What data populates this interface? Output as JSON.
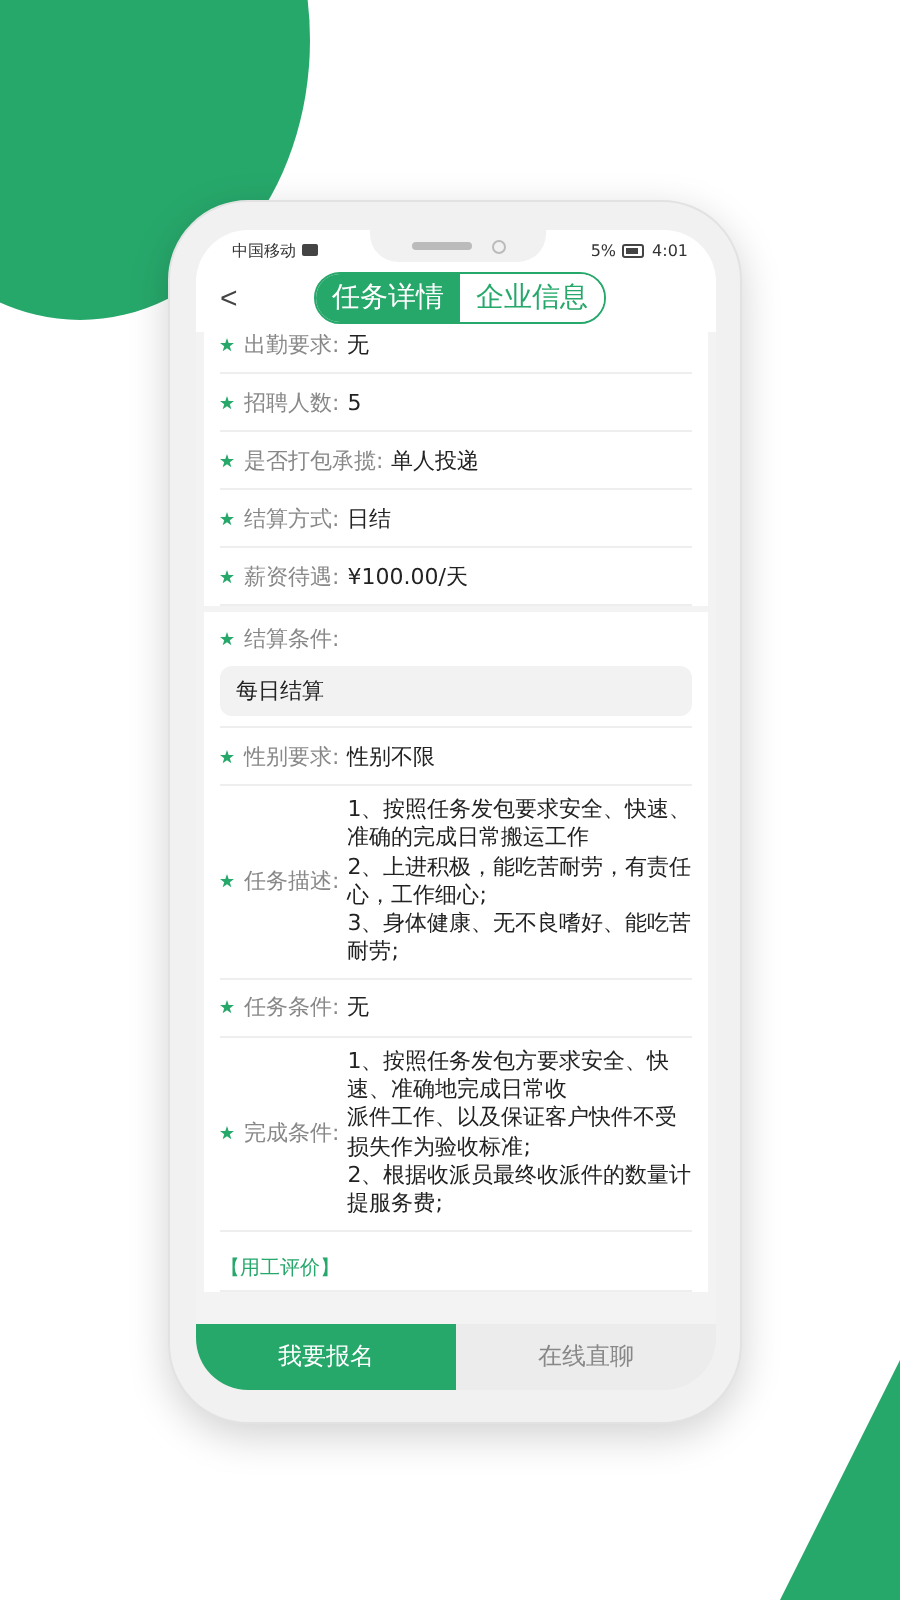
{
  "status_bar": {
    "carrier": "中国移动",
    "battery": "5%",
    "time": "4:01"
  },
  "header": {
    "back": "<",
    "tabs": [
      {
        "label": "任务详情",
        "selected": true
      },
      {
        "label": "企业信息",
        "selected": false
      }
    ]
  },
  "fields": [
    {
      "kind": "row",
      "label": "出勤要求:",
      "value": "无",
      "required": true
    },
    {
      "kind": "row",
      "label": "招聘人数:",
      "value": "5",
      "required": true
    },
    {
      "kind": "row",
      "label": "是否打包承揽:",
      "value": "单人投递",
      "required": true
    },
    {
      "kind": "row",
      "label": "结算方式:",
      "value": "日结",
      "required": true
    },
    {
      "kind": "row",
      "label": "薪资待遇:",
      "value": "¥100.00/天",
      "required": true
    },
    {
      "kind": "block",
      "label": "结算条件:",
      "value": "每日结算",
      "required": true
    },
    {
      "kind": "row",
      "label": "性别要求:",
      "value": "性别不限",
      "required": true
    },
    {
      "kind": "multi",
      "label": "任务描述:",
      "lines": [
        "1、按照任务发包要求安全、快速、准确的完成日常搬运工作",
        "2、上进积极，能吃苦耐劳，有责任心，工作细心;",
        "3、身体健康、无不良嗜好、能吃苦耐劳;"
      ],
      "required": true
    },
    {
      "kind": "row",
      "label": "任务条件:",
      "value": "无",
      "required": true
    },
    {
      "kind": "multi",
      "label": "完成条件:",
      "lines": [
        "1、按照任务发包方要求安全、快速、准确地完成日常收",
        "派件工作、以及保证客户快件不受损失作为验收标准;",
        "2、根据收派员最终收派件的数量计提服务费;"
      ],
      "required": true
    }
  ],
  "review_title": "【用工评价】",
  "buttons": [
    {
      "label": "我要报名",
      "kind": "primary"
    },
    {
      "label": "在线直聊",
      "kind": "secondary"
    }
  ]
}
